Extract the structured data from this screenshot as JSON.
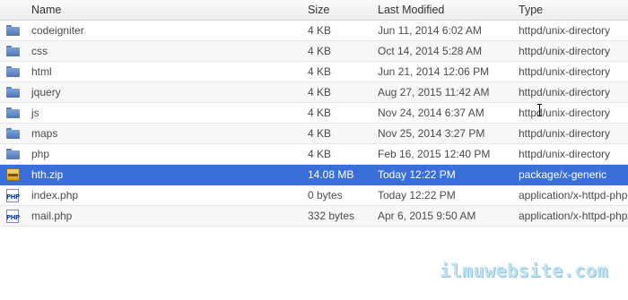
{
  "columns": {
    "name": "Name",
    "size": "Size",
    "modified": "Last Modified",
    "type": "Type"
  },
  "files": [
    {
      "icon": "folder-icon",
      "name": "codeigniter",
      "size": "4 KB",
      "modified": "Jun 11, 2014 6:02 AM",
      "type": "httpd/unix-directory"
    },
    {
      "icon": "folder-icon",
      "name": "css",
      "size": "4 KB",
      "modified": "Oct 14, 2014 5:28 AM",
      "type": "httpd/unix-directory"
    },
    {
      "icon": "folder-icon",
      "name": "html",
      "size": "4 KB",
      "modified": "Jun 21, 2014 12:06 PM",
      "type": "httpd/unix-directory"
    },
    {
      "icon": "folder-icon",
      "name": "jquery",
      "size": "4 KB",
      "modified": "Aug 27, 2015 11:42 AM",
      "type": "httpd/unix-directory"
    },
    {
      "icon": "folder-icon",
      "name": "js",
      "size": "4 KB",
      "modified": "Nov 24, 2014 6:37 AM",
      "type": "httpd/unix-directory"
    },
    {
      "icon": "folder-icon",
      "name": "maps",
      "size": "4 KB",
      "modified": "Nov 25, 2014 3:27 PM",
      "type": "httpd/unix-directory"
    },
    {
      "icon": "folder-icon",
      "name": "php",
      "size": "4 KB",
      "modified": "Feb 16, 2015 12:40 PM",
      "type": "httpd/unix-directory"
    },
    {
      "icon": "zip-icon",
      "name": "hth.zip",
      "size": "14.08 MB",
      "modified": "Today 12:22 PM",
      "type": "package/x-generic",
      "selected": true
    },
    {
      "icon": "php-icon",
      "name": "index.php",
      "size": "0 bytes",
      "modified": "Today 12:22 PM",
      "type": "application/x-httpd-php"
    },
    {
      "icon": "php-icon",
      "name": "mail.php",
      "size": "332 bytes",
      "modified": "Apr 6, 2015 9:50 AM",
      "type": "application/x-httpd-php"
    }
  ],
  "php_icon_text": "PHP",
  "watermark": "ilmuwebsite.com",
  "colors": {
    "selection": "#3a6fd9",
    "folder": "#5b7fb8",
    "watermark": "#bfe3f5"
  }
}
